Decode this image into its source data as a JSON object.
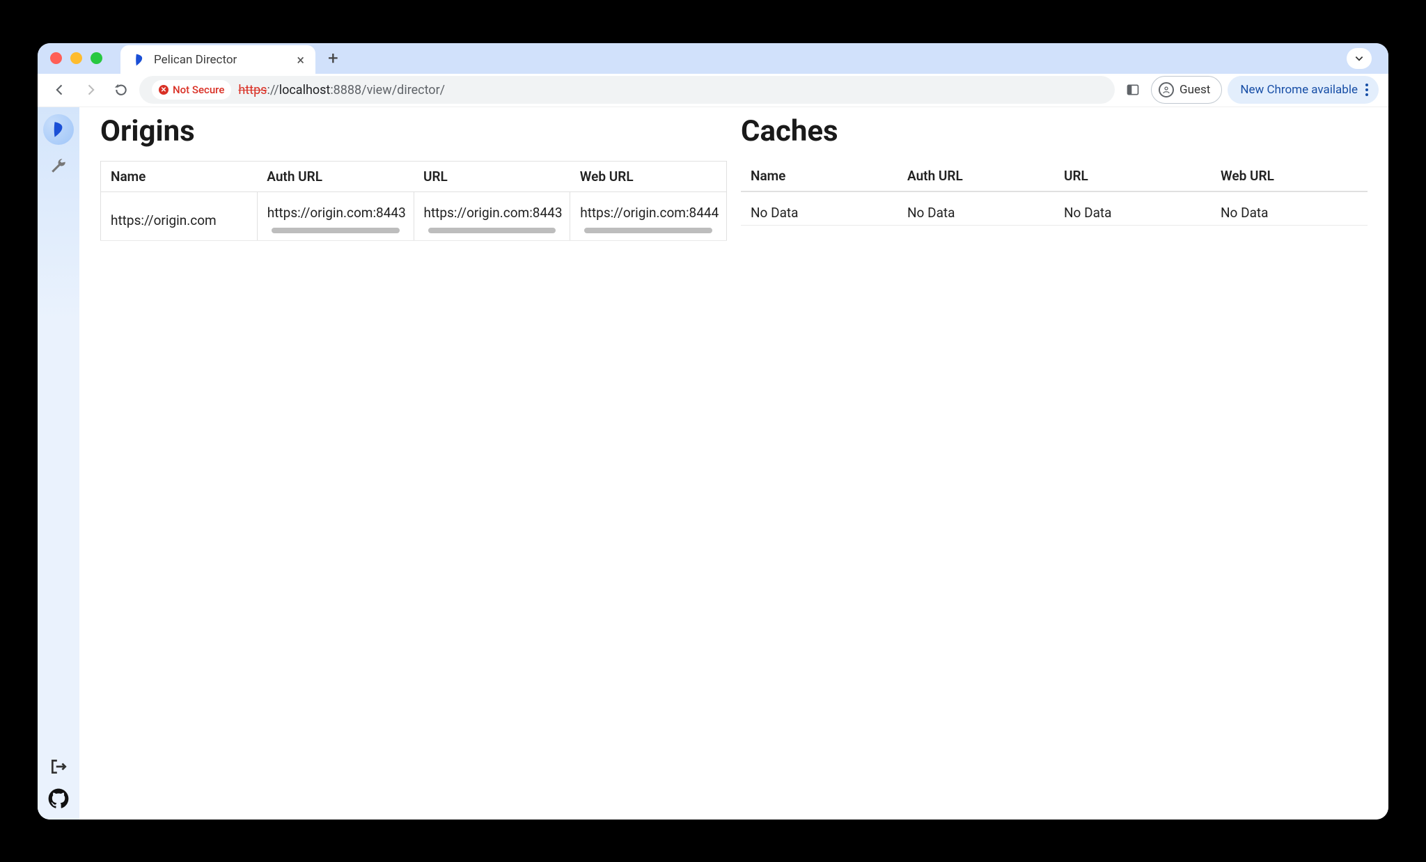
{
  "browser": {
    "tab_title": "Pelican Director",
    "not_secure": "Not Secure",
    "url_scheme": "https",
    "url_sep": "://",
    "url_host": "localhost",
    "url_port": ":8888",
    "url_path": "/view/director/",
    "guest_label": "Guest",
    "update_label": "New Chrome available"
  },
  "page": {
    "origins": {
      "title": "Origins",
      "columns": [
        "Name",
        "Auth URL",
        "URL",
        "Web URL"
      ],
      "rows": [
        {
          "name": "https://origin.com",
          "auth_url": "https://origin.com:8443",
          "url": "https://origin.com:8443",
          "web_url": "https://origin.com:8444"
        }
      ]
    },
    "caches": {
      "title": "Caches",
      "columns": [
        "Name",
        "Auth URL",
        "URL",
        "Web URL"
      ],
      "empty_text": "No Data"
    }
  }
}
